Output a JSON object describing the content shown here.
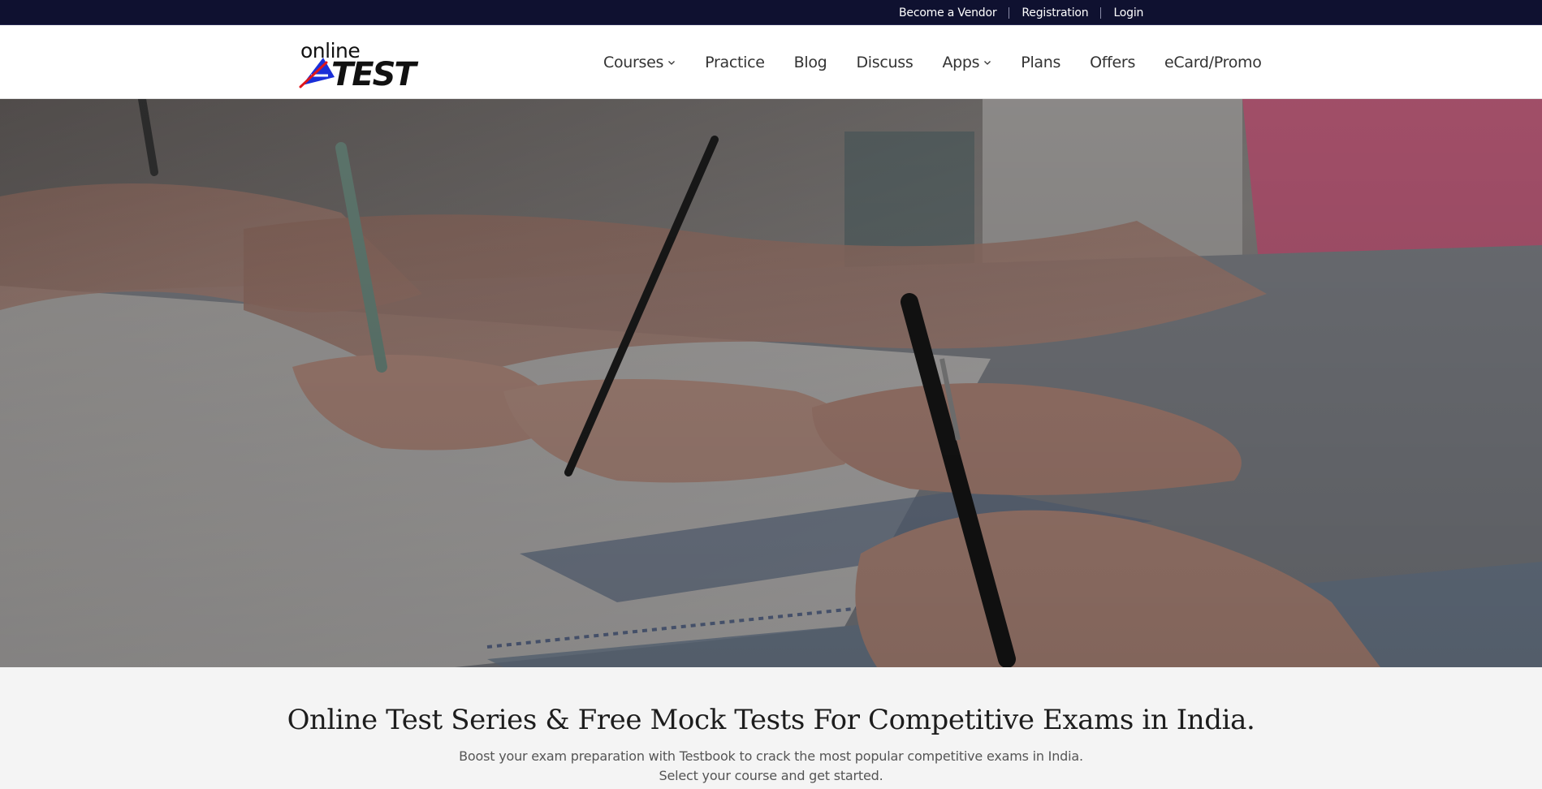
{
  "topbar": {
    "links": [
      "Become a Vendor",
      "Registration",
      "Login"
    ]
  },
  "logo": {
    "top_text": "online",
    "main_text": "TEST"
  },
  "nav": {
    "items": [
      {
        "label": "Courses",
        "dropdown": true
      },
      {
        "label": "Practice",
        "dropdown": false
      },
      {
        "label": "Blog",
        "dropdown": false
      },
      {
        "label": "Discuss",
        "dropdown": false
      },
      {
        "label": "Apps",
        "dropdown": true
      },
      {
        "label": "Plans",
        "dropdown": false
      },
      {
        "label": "Offers",
        "dropdown": false
      },
      {
        "label": "eCard/Promo",
        "dropdown": false
      }
    ]
  },
  "intro": {
    "heading": "Online Test Series & Free Mock Tests For Competitive Exams in India.",
    "line1": "Boost your exam preparation with Testbook to crack the most popular competitive exams in India.",
    "line2": "Select your course and get started."
  },
  "colors": {
    "topbar_bg": "#0f1130",
    "header_bg": "#ffffff",
    "body_bg": "#f4f4f4",
    "logo_blue": "#1a2fd8",
    "logo_red": "#e0161b"
  }
}
